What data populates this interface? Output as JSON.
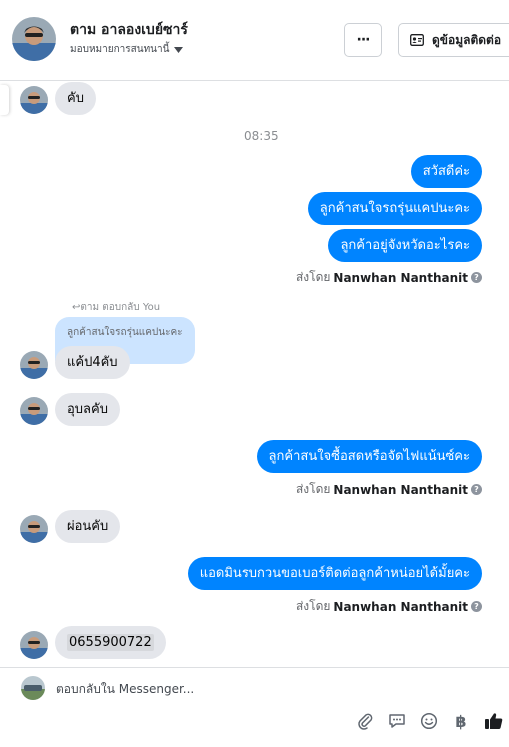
{
  "header": {
    "contact_name": "ตาม อาลองเบย์ซาร์",
    "assign_label": "มอบหมายการสนทนานี้",
    "more_label": "···",
    "view_contact_label": "ดูข้อมูลติดต่อ",
    "avatar_icon": "profile-photo"
  },
  "thread": {
    "messages": [
      {
        "text": "คับ"
      },
      {
        "timestamp": "08:35"
      },
      {
        "text": "สวัสดีค่ะ"
      },
      {
        "text": "ลูกค้าสนใจรถรุ่นแคปนะคะ"
      },
      {
        "text": "ลูกค้าอยู่จังหวัดอะไรคะ"
      },
      {
        "sent_by_prefix": "ส่งโดย",
        "sent_by_name": "Nanwhan Nanthanit"
      },
      {
        "reply_label": "ตาม ตอบกลับ You",
        "quoted": "ลูกค้าสนใจรถรุ่นแคปนะคะ",
        "text": "แค้ป4คับ"
      },
      {
        "text": "อุบลคับ"
      },
      {
        "text": "ลูกค้าสนใจซื้อสดหรือจัดไฟแน้นซ์คะ"
      },
      {
        "sent_by_prefix": "ส่งโดย",
        "sent_by_name": "Nanwhan Nanthanit"
      },
      {
        "text": "ผ่อนคับ"
      },
      {
        "text": "แอดมินรบกวนขอเบอร์ติดต่อลูกค้าหน่อยได้มั้ยคะ"
      },
      {
        "sent_by_prefix": "ส่งโดย",
        "sent_by_name": "Nanwhan Nanthanit"
      },
      {
        "text": "0655900722"
      }
    ]
  },
  "composer": {
    "placeholder": "ตอบกลับใน Messenger...",
    "tools": [
      "attachment-icon",
      "saved-reply-icon",
      "emoji-icon",
      "payment-baht-icon",
      "like-icon"
    ]
  },
  "colors": {
    "outgoing_bubble": "#0084ff",
    "incoming_bubble": "#e4e6eb",
    "quoted_bubble": "#cce4ff",
    "like_icon": "#1c1e21"
  }
}
